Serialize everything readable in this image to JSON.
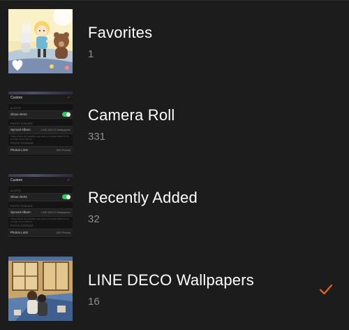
{
  "albums": [
    {
      "title": "Favorites",
      "count": "1",
      "thumb": "illustration-girl-with-bear",
      "badge_icon": "heart-icon",
      "selected": false
    },
    {
      "title": "Camera Roll",
      "count": "331",
      "thumb": "settings-screenshot",
      "selected": false
    },
    {
      "title": "Recently Added",
      "count": "32",
      "thumb": "settings-screenshot",
      "selected": false
    },
    {
      "title": "LINE DECO Wallpapers",
      "count": "16",
      "thumb": "illustration-couple-in-room",
      "selected": true
    }
  ],
  "thumbnail_text": {
    "nav_title": "Custom",
    "nav_close": "✓",
    "section_alerts": "ALERTS",
    "show_alerts": "Show Alerts",
    "section_photo_syncing": "PHOTO SYNCING",
    "synced_album_label": "Synced Album",
    "synced_album_value": "LINE DECO Wallpapers",
    "sync_note": "These photos are viewable even when your Apple Watch is out of range of your iPhone.",
    "section_photo_storage": "PHOTO STORAGE",
    "photos_limit_label": "Photos Limit",
    "photos_limit_value": "500 Photos"
  },
  "colors": {
    "background": "#1c1c1c",
    "title": "#ffffff",
    "count": "#8e8e8e",
    "checkmark": "#e8651f",
    "toggle_on": "#34c759"
  }
}
